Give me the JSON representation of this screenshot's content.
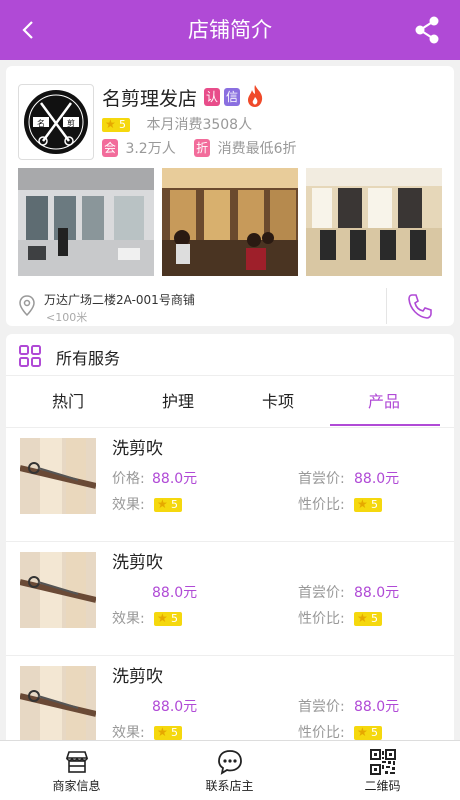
{
  "header": {
    "title": "店铺简介"
  },
  "shop": {
    "name": "名剪理发店",
    "badge_auth": "认",
    "badge_trust": "信",
    "rating": "5",
    "monthly_sales": "本月消费3508人",
    "member_tag": "会",
    "members": "3.2万人",
    "discount_tag": "折",
    "discount": "消费最低6折",
    "address": "万达广场二楼2A-001号商铺",
    "distance": "<100米",
    "logo_text_left": "名",
    "logo_text_right": "剪"
  },
  "services": {
    "title": "所有服务",
    "tabs": [
      "热门",
      "护理",
      "卡项",
      "产品"
    ],
    "active_tab": 3,
    "items": [
      {
        "name": "洗剪吹",
        "price_label": "价格:",
        "price": "88.0元",
        "first_label": "首尝价:",
        "first_price": "88.0元",
        "effect_label": "效果:",
        "effect": "5",
        "value_label": "性价比:",
        "value": "5"
      },
      {
        "name": "洗剪吹",
        "price_label": "",
        "price": "88.0元",
        "first_label": "首尝价:",
        "first_price": "88.0元",
        "effect_label": "效果:",
        "effect": "5",
        "value_label": "性价比:",
        "value": "5"
      },
      {
        "name": "洗剪吹",
        "price_label": "",
        "price": "88.0元",
        "first_label": "首尝价:",
        "first_price": "88.0元",
        "effect_label": "效果:",
        "effect": "5",
        "value_label": "性价比:",
        "value": "5"
      }
    ]
  },
  "bottom_nav": [
    {
      "label": "商家信息",
      "icon": "store-icon"
    },
    {
      "label": "联系店主",
      "icon": "chat-icon"
    },
    {
      "label": "二维码",
      "icon": "qrcode-icon"
    }
  ],
  "colors": {
    "accent": "#b04ad6",
    "star": "#f5d80e"
  }
}
